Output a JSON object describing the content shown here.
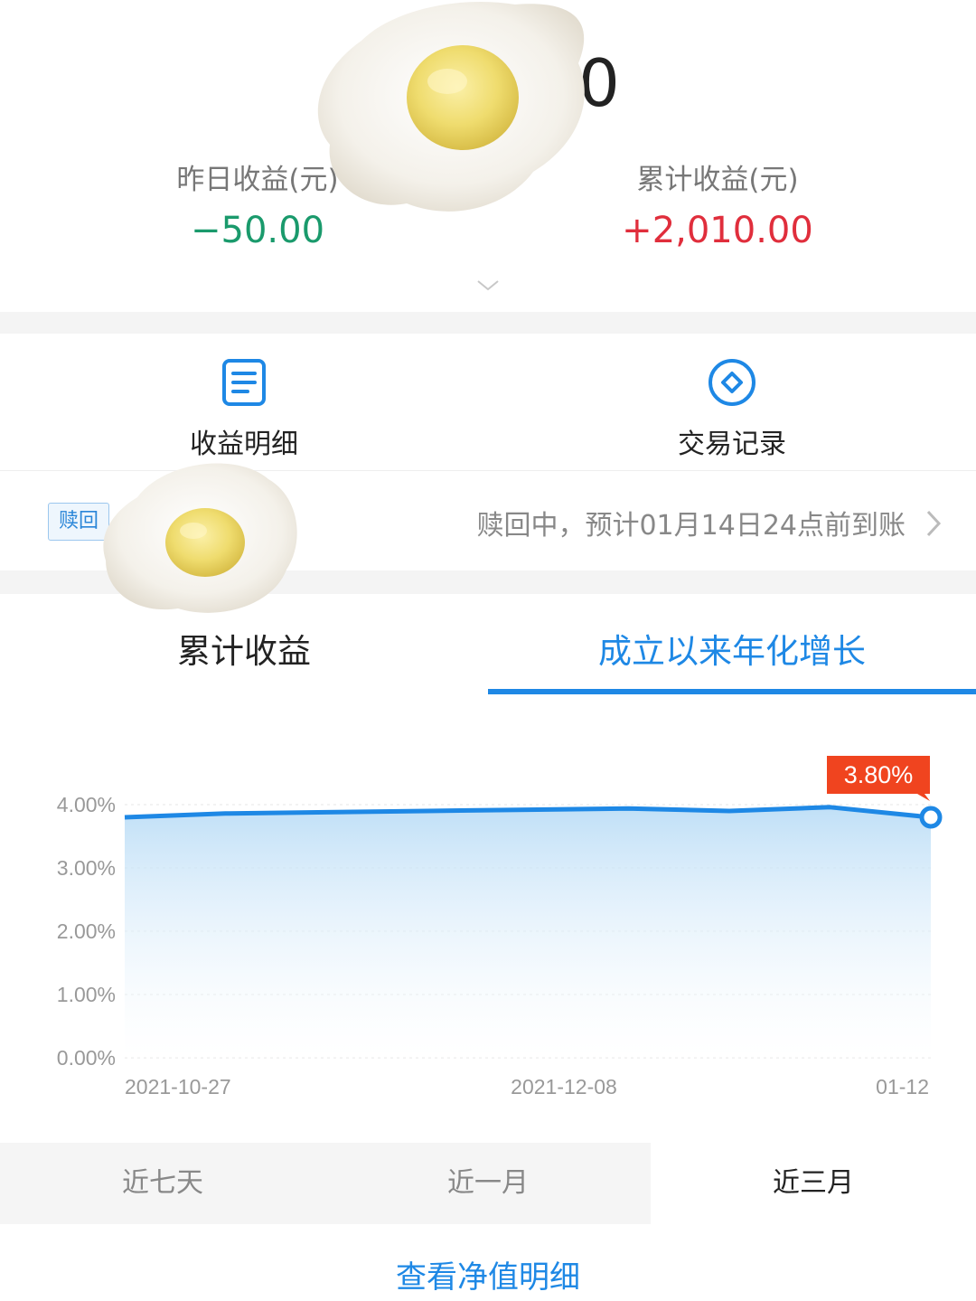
{
  "summary": {
    "total_partial": "0",
    "yesterday_label": "昨日收益(元)",
    "yesterday_value": "−50.00",
    "cumulative_label": "累计收益(元)",
    "cumulative_value": "+2,010.00",
    "colors": {
      "negative": "#1a9a6c",
      "positive": "#e02e3c"
    }
  },
  "actions": [
    {
      "label": "收益明细",
      "icon": "document-icon"
    },
    {
      "label": "交易记录",
      "icon": "diamond-icon"
    }
  ],
  "redeem": {
    "badge": "赎回",
    "text": "赎回中，预计01月14日24点前到账"
  },
  "tabs": [
    {
      "label": "累计收益",
      "active": false
    },
    {
      "label": "成立以来年化增长",
      "active": true
    }
  ],
  "chart_data": {
    "type": "area",
    "title": "",
    "xlabel": "",
    "ylabel": "",
    "ylim": [
      0,
      4
    ],
    "yticks": [
      "0.00%",
      "1.00%",
      "2.00%",
      "3.00%",
      "4.00%"
    ],
    "x_tick_labels": [
      "2021-10-27",
      "2021-12-08",
      "01-12"
    ],
    "x": [
      "2021-10-27",
      "2021-11-06",
      "2021-11-16",
      "2021-11-26",
      "2021-12-06",
      "2021-12-16",
      "2021-12-26",
      "2022-01-05",
      "2022-01-12"
    ],
    "series": [
      {
        "values": [
          3.8,
          3.86,
          3.88,
          3.9,
          3.92,
          3.94,
          3.9,
          3.96,
          3.8
        ]
      }
    ],
    "highlight": {
      "value": "3.80%",
      "index": 8
    },
    "grid": true,
    "line_color": "#1e88e5"
  },
  "ranges": [
    {
      "label": "近七天",
      "active": false
    },
    {
      "label": "近一月",
      "active": false
    },
    {
      "label": "近三月",
      "active": true
    }
  ],
  "footer_link": "查看净值明细"
}
